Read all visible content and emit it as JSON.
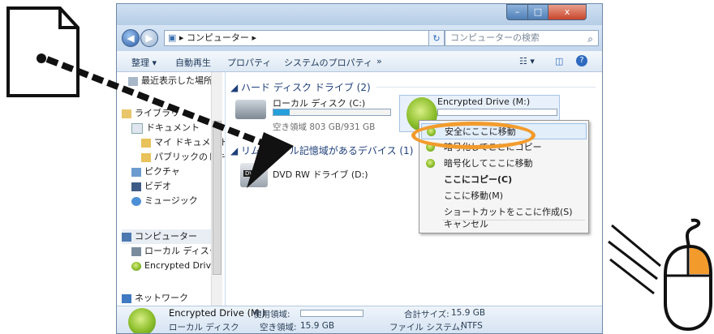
{
  "window": {
    "address": "コンピューター",
    "search_placeholder": "コンピューターの検索",
    "caption": {
      "minimize": "–",
      "maximize": "□",
      "close": "x"
    }
  },
  "toolbar": {
    "organize": "整理 ▾",
    "autoplay": "自動再生",
    "properties": "プロパティ",
    "system_properties": "システムのプロパティ",
    "more": "»",
    "view": "☷ ▾",
    "help": "?"
  },
  "nav": {
    "items": [
      {
        "label": "最近表示した場所",
        "level": 1
      },
      {
        "label": "ライブラリ",
        "level": 0
      },
      {
        "label": "ドキュメント",
        "level": 1
      },
      {
        "label": "マイ ドキュメント",
        "level": 2
      },
      {
        "label": "パブリックのドキュメント",
        "level": 2
      },
      {
        "label": "ピクチャ",
        "level": 1
      },
      {
        "label": "ビデオ",
        "level": 1
      },
      {
        "label": "ミュージック",
        "level": 1
      },
      {
        "label": "コンピューター",
        "level": 0
      },
      {
        "label": "ローカル ディスク",
        "level": 1
      },
      {
        "label": "Encrypted Drive",
        "level": 1
      },
      {
        "label": "ネットワーク",
        "level": 0
      }
    ]
  },
  "main": {
    "group_hdd": "◢ ハード ディスク ドライブ (2)",
    "group_removable": "◢ リムーバブル記憶域があるデバイス (1)",
    "local_disk_name": "ローカル ディスク (C:)",
    "local_disk_free": "空き領域 803 GB/931 GB",
    "encrypted_name": "Encrypted Drive (M:)",
    "dvd_name": "DVD RW ドライブ (D:)"
  },
  "context_menu": {
    "items": [
      {
        "label": "安全にここに移動",
        "icon": "encrypt-icon",
        "bold": false
      },
      {
        "label": "暗号化してここにコピー",
        "icon": "encrypt-icon",
        "bold": false
      },
      {
        "label": "暗号化してここに移動",
        "icon": "encrypt-icon",
        "bold": false
      },
      {
        "label": "ここにコピー(C)",
        "icon": "",
        "bold": true
      },
      {
        "label": "ここに移動(M)",
        "icon": "",
        "bold": false
      },
      {
        "label": "ショートカットをここに作成(S)",
        "icon": "",
        "bold": false
      },
      {
        "label": "キャンセル",
        "icon": "",
        "bold": false
      }
    ]
  },
  "details": {
    "name": "Encrypted Drive (M:)",
    "type": "ローカル ディスク",
    "used_label": "使用領域:",
    "free_label": "空き領域:",
    "free_value": "15.9 GB",
    "total_label": "合計サイズ:",
    "total_value": "15.9 GB",
    "fs_label": "ファイル システム:",
    "fs_value": "NTFS"
  },
  "colors": {
    "accent_orange": "#f29b2c",
    "window_frame": "#c9dcef",
    "menu_highlight": "#e3eefb"
  }
}
